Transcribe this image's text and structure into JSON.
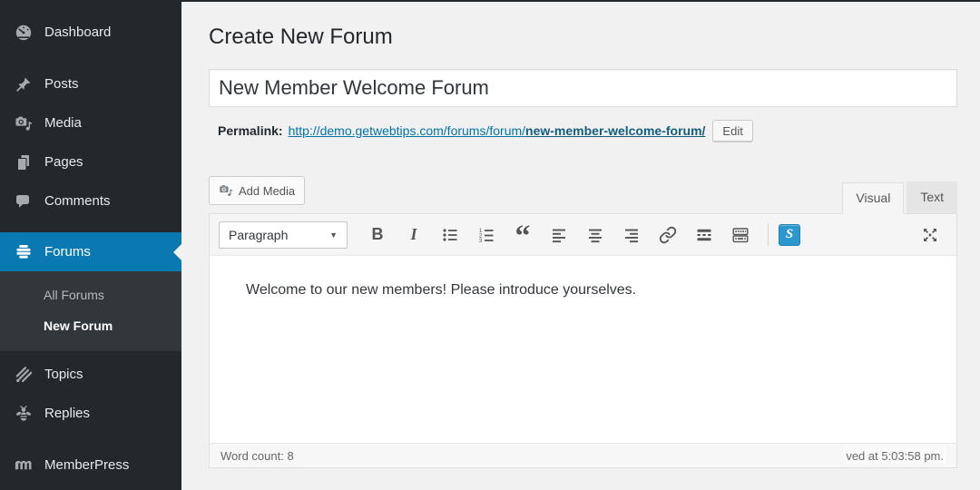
{
  "colors": {
    "accent_blue": "#0a79b2",
    "sidebar_bg": "#23282d",
    "submenu_bg": "#32373c",
    "link_blue": "#0073aa",
    "shortcode_blue": "#2b97cc"
  },
  "sidebar": {
    "items": [
      {
        "label": "Dashboard",
        "icon": "dashboard-gauge-icon"
      },
      {
        "label": "Posts",
        "icon": "pushpin-icon"
      },
      {
        "label": "Media",
        "icon": "camera-note-icon"
      },
      {
        "label": "Pages",
        "icon": "stacked-pages-icon"
      },
      {
        "label": "Comments",
        "icon": "comment-bubble-icon"
      },
      {
        "label": "Forums",
        "icon": "forums-hive-icon",
        "active": true
      },
      {
        "label": "Topics",
        "icon": "topics-strokes-icon"
      },
      {
        "label": "Replies",
        "icon": "bee-icon"
      },
      {
        "label": "MemberPress",
        "icon": "memberpress-m-icon"
      }
    ],
    "forums_submenu": [
      {
        "label": "All Forums",
        "current": false
      },
      {
        "label": "New Forum",
        "current": true
      }
    ]
  },
  "main": {
    "page_title": "Create New Forum",
    "title_input": {
      "value": "New Member Welcome Forum"
    },
    "permalink": {
      "label": "Permalink:",
      "base_url": "http://demo.getwebtips.com/forums/forum/",
      "slug": "new-member-welcome-forum/",
      "edit_button": "Edit"
    },
    "editor": {
      "add_media_button": "Add Media",
      "tabs": {
        "visual": "Visual",
        "text": "Text"
      },
      "toolbar": {
        "paragraph_dropdown": "Paragraph",
        "bold_glyph": "B",
        "italic_glyph": "I",
        "blockquote_glyph": "“",
        "shortcode_glyph": "S"
      },
      "content": "Welcome to our new members! Please introduce yourselves.",
      "status_bar": {
        "word_count_label": "Word count:",
        "word_count_value": "8",
        "autosave_text": "ved at 5:03:58 pm."
      }
    }
  }
}
